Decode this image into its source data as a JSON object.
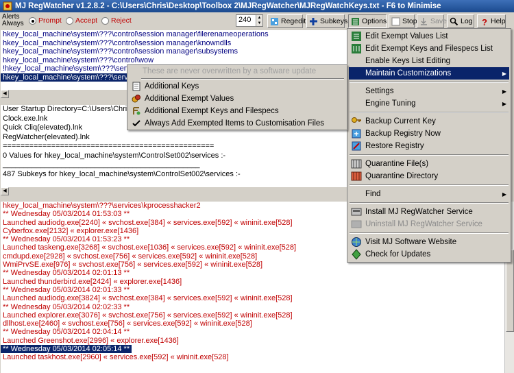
{
  "window": {
    "title": "MJ RegWatcher v1.2.8.2 - C:\\Users\\Chris\\Desktop\\Toolbox 2\\MJRegWatcher\\MJRegWatchKeys.txt - F6 to Minimise"
  },
  "toolbar": {
    "alerts_label": "Alerts Always",
    "radio_prompt": "Prompt",
    "radio_accept": "Accept",
    "radio_reject": "Reject",
    "interval_value": "240",
    "regedit": "Regedit",
    "subkeys": "Subkeys",
    "options": "Options",
    "stop": "Stop",
    "save": "Save",
    "log": "Log",
    "help": "Help"
  },
  "keys_pane": {
    "lines": [
      "hkey_local_machine\\system\\???\\control\\session manager\\filerenameoperations",
      "hkey_local_machine\\system\\???\\control\\session manager\\knowndlls",
      "hkey_local_machine\\system\\???\\control\\session manager\\subsystems",
      "hkey_local_machine\\system\\???\\control\\wow",
      "!hkey_local_machine\\system\\???\\servic",
      "hkey_local_machine\\system\\???\\servic"
    ]
  },
  "info_pane": {
    "lines": [
      "User Startup Directory=C:\\Users\\Chri",
      "Clock.exe.lnk",
      "Quick Cliq(elevated).lnk",
      "RegWatcher(elevated).lnk",
      "================================================",
      "0 Values for hkey_local_machine\\system\\ControlSet002\\services :-",
      "_______________________________________________",
      "487 Subkeys for hkey_local_machine\\system\\ControlSet002\\services :-"
    ]
  },
  "log_pane": {
    "lines": [
      "hkey_local_machine\\system\\???\\services\\kprocesshacker2",
      "** Wednesday 05/03/2014 01:53:03 **",
      "Launched audiodg.exe[2240] « svchost.exe[384] « services.exe[592] « wininit.exe[528]",
      "Cyberfox.exe[2132] « explorer.exe[1436]",
      "** Wednesday 05/03/2014 01:53:23 **",
      "Launched taskeng.exe[3268] « svchost.exe[1036] « services.exe[592] « wininit.exe[528]",
      "cmdupd.exe[2928] « svchost.exe[756] « services.exe[592] « wininit.exe[528]",
      "WmiPrvSE.exe[976] « svchost.exe[756] « services.exe[592] « wininit.exe[528]",
      "** Wednesday 05/03/2014 02:01:13 **",
      "Launched thunderbird.exe[2424] « explorer.exe[1436]",
      "** Wednesday 05/03/2014 02:01:33 **",
      "Launched audiodg.exe[3824] « svchost.exe[384] « services.exe[592] « wininit.exe[528]",
      "** Wednesday 05/03/2014 02:02:33 **",
      "Launched explorer.exe[3076] « svchost.exe[756] « services.exe[592] « wininit.exe[528]",
      "dllhost.exe[2460] « svchost.exe[756] « services.exe[592] « wininit.exe[528]",
      "** Wednesday 05/03/2014 02:04:14 **",
      "Launched Greenshot.exe[2996] « explorer.exe[1436]",
      "** Wednesday 05/03/2014 02:05:14 **",
      "Launched taskhost.exe[2960] « services.exe[592] « wininit.exe[528]"
    ]
  },
  "options_menu": {
    "edit_exempt_values": "Edit Exempt Values List",
    "edit_exempt_keys": "Edit Exempt Keys and Filespecs List",
    "enable_keys_editing": "Enable Keys List Editing",
    "maintain_customizations": "Maintain Customizations",
    "settings": "Settings",
    "engine_tuning": "Engine Tuning",
    "backup_current_key": "Backup Current Key",
    "backup_registry_now": "Backup Registry Now",
    "restore_registry": "Restore Registry",
    "quarantine_files": "Quarantine File(s)",
    "quarantine_directory": "Quarantine Directory",
    "find": "Find",
    "install_service": "Install MJ RegWatcher Service",
    "uninstall_service": "Uninstall MJ RegWatcher Service",
    "visit_website": "Visit MJ Software Website",
    "check_updates": "Check for Updates"
  },
  "customizations_submenu": {
    "header": "These are never overwritten by a software update",
    "additional_keys": "Additional Keys",
    "additional_exempt_values": "Additional Exempt Values",
    "additional_exempt_keys": "Additional Exempt Keys and Filespecs",
    "always_add_exempted": "Always Add Exempted Items to Customisation Files"
  },
  "colors": {
    "highlight": "#0a246a",
    "log_text": "#c00000",
    "key_text": "#000080",
    "title_bar": "#1b4a8e"
  }
}
